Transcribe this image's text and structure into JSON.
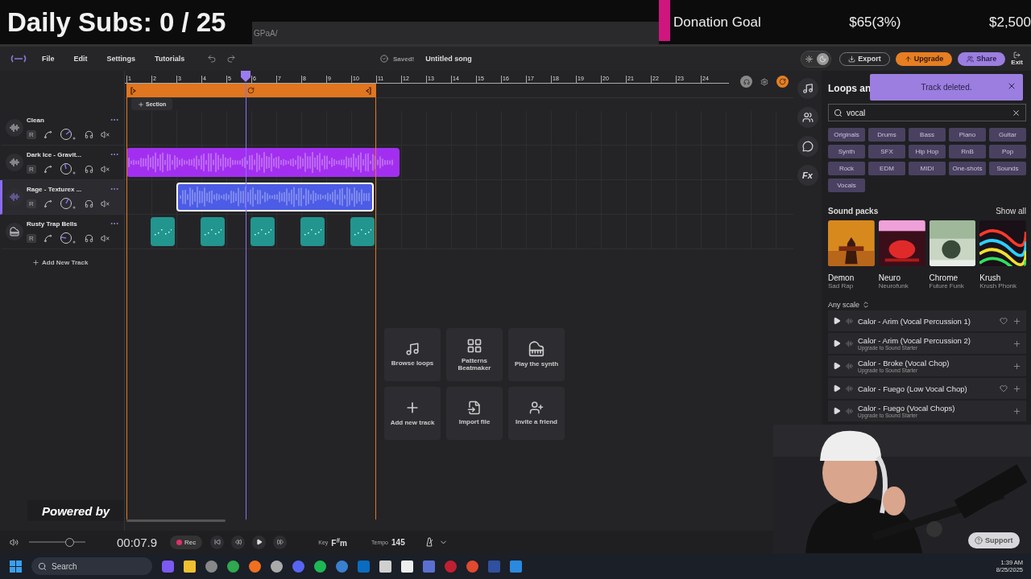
{
  "overlay": {
    "subs": "Daily Subs: 0 / 25",
    "url_fragment": "GPaA/",
    "donation": {
      "label": "Donation Goal",
      "raised": "$65(3%)",
      "goal": "$2,500",
      "level": 0.03
    },
    "powered_by": "Powered by"
  },
  "menu": [
    "File",
    "Edit",
    "Settings",
    "Tutorials"
  ],
  "status": {
    "saved": "Saved!",
    "song_title": "Untitled song"
  },
  "theme_toggle": {
    "dark": true
  },
  "header_buttons": [
    {
      "label": "Export",
      "kind": "outline"
    },
    {
      "label": "Upgrade",
      "kind": "orange"
    },
    {
      "label": "Share",
      "kind": "purple"
    }
  ],
  "exit": "Exit",
  "ruler": [
    "1",
    "2",
    "3",
    "4",
    "5",
    "6",
    "7",
    "8",
    "9",
    "10",
    "11",
    "12",
    "13",
    "14",
    "15",
    "16",
    "17",
    "18",
    "19",
    "20",
    "21",
    "22",
    "23",
    "24"
  ],
  "section_button": "Section",
  "tracks": [
    {
      "name": "Clean",
      "kind": "audio",
      "selected": false,
      "arm": "R"
    },
    {
      "name": "Dark Ice - Gravit...",
      "kind": "audio",
      "selected": false,
      "arm": "R",
      "color": "#a22ff0"
    },
    {
      "name": "Rage - Texturex ...",
      "kind": "audio",
      "selected": true,
      "arm": "R",
      "color": "#4c5ce6"
    },
    {
      "name": "Rusty Trap Bells",
      "kind": "instrument",
      "selected": false,
      "arm": "R",
      "color": "#22958f"
    }
  ],
  "add_track": "Add New Track",
  "quick_actions": [
    {
      "label": "Browse loops",
      "kind": "loops"
    },
    {
      "label": "Patterns Beatmaker",
      "kind": "patterns"
    },
    {
      "label": "Play the synth",
      "kind": "synth"
    },
    {
      "label": "Add new track",
      "kind": "add"
    },
    {
      "label": "Import file",
      "kind": "import"
    },
    {
      "label": "Invite a friend",
      "kind": "invite"
    }
  ],
  "side_tools": [
    {
      "kind": "music"
    },
    {
      "kind": "people"
    },
    {
      "kind": "chat"
    },
    {
      "kind": "fx",
      "label": "Fx"
    }
  ],
  "panel": {
    "title": "Loops an",
    "search": {
      "value": "vocal"
    },
    "filters": [
      "Originals",
      "Drums",
      "Bass",
      "Piano",
      "Guitar",
      "Synth",
      "SFX",
      "Hip Hop",
      "RnB",
      "Pop",
      "Rock",
      "EDM",
      "MIDI",
      "One-shots",
      "Sounds",
      "Vocals"
    ],
    "packs_title": "Sound packs",
    "show_all": "Show all",
    "packs": [
      {
        "name": "Demon",
        "genre": "Sad Rap"
      },
      {
        "name": "Neuro",
        "genre": "Neurofunk"
      },
      {
        "name": "Chrome",
        "genre": "Future Funk"
      },
      {
        "name": "Krush",
        "genre": "Krush Phonk"
      }
    ],
    "scale": "Any scale",
    "loops": [
      {
        "name": "Calor - Arim (Vocal Percussion 1)",
        "heart": true
      },
      {
        "name": "Calor - Arim (Vocal Percussion 2)",
        "subtitle": "Upgrade to Sound Starter",
        "heart": false
      },
      {
        "name": "Calor - Broke (Vocal Chop)",
        "subtitle": "Upgrade to Sound Starter",
        "heart": false
      },
      {
        "name": "Calor - Fuego (Low Vocal Chop)",
        "heart": true
      },
      {
        "name": "Calor - Fuego (Vocal Chops)",
        "subtitle": "Upgrade to Sound Starter",
        "heart": false
      }
    ]
  },
  "toast": {
    "message": "Track deleted."
  },
  "transport": {
    "level": 0.72,
    "time": "00:07.9",
    "rec": "Rec",
    "key_label": "Key",
    "key": "F$^{#}$m",
    "tempo_label": "Tempo",
    "tempo": "145"
  },
  "taskbar": {
    "search": "Search",
    "time": "1:39 AM",
    "date": "8/25/2025"
  },
  "support": "Support"
}
